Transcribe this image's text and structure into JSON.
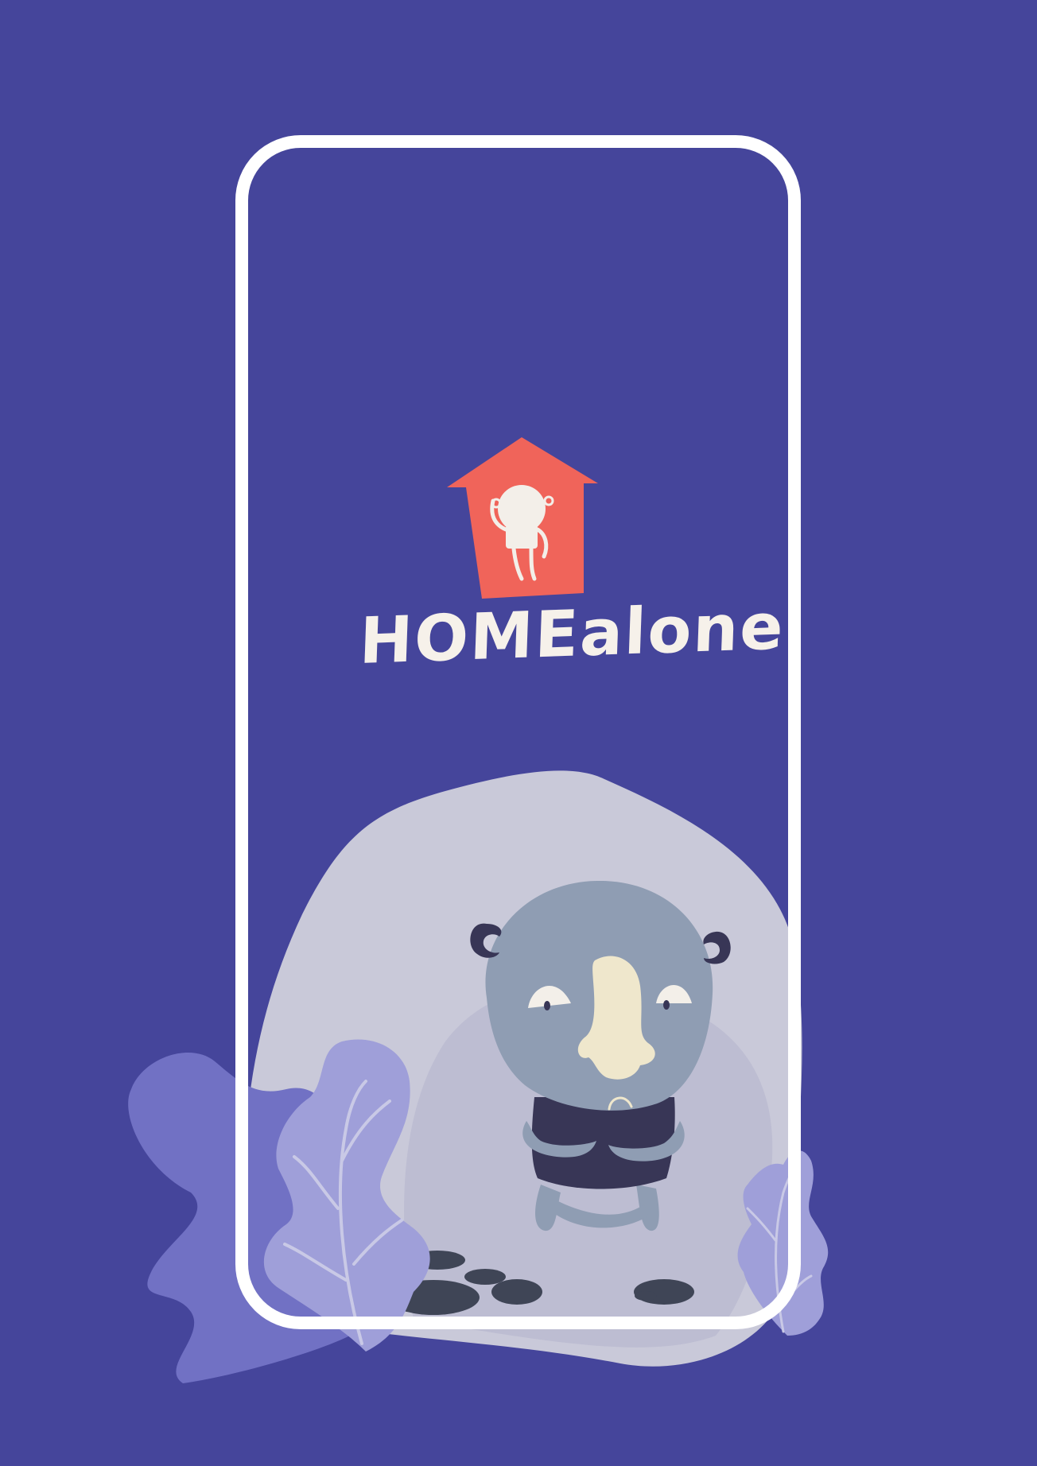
{
  "app": {
    "name": "HOMEalone"
  },
  "colors": {
    "background": "#45459b",
    "frame": "#ffffff",
    "logo_house": "#f0645a",
    "logo_figure": "#f3efe9",
    "title_text": "#f6f1ea",
    "blob_light": "#c9c9d9",
    "blob_inner": "#bdbdd2",
    "leaf_dark": "#7171c4",
    "leaf_light": "#9f9fd9",
    "character_skin": "#8f9db3",
    "character_body": "#383656",
    "character_nose": "#efe7cc",
    "rocks": "#3f4556"
  },
  "icons": {
    "logo": "house-with-waving-figure-icon",
    "mascot": "sad-rhino-character-illustration",
    "left_leaf": "leaf-icon",
    "right_leaf": "leaf-icon",
    "rocks": "rocks-icon"
  }
}
